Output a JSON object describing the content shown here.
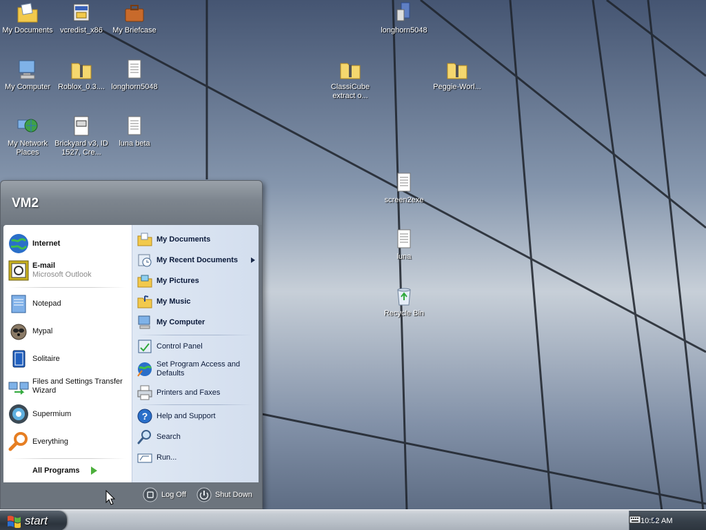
{
  "desktop": {
    "icons": [
      {
        "label": "My Documents"
      },
      {
        "label": "vcredist_x86"
      },
      {
        "label": "My Briefcase"
      },
      {
        "label": "longhorn5048"
      },
      {
        "label": "My Computer"
      },
      {
        "label": "Roblox_0.3...."
      },
      {
        "label": "longhorn5048"
      },
      {
        "label": "ClassiCube extract o..."
      },
      {
        "label": "Peggie-Worl..."
      },
      {
        "label": "My Network Places"
      },
      {
        "label": "Brickyard v3, ID 1527, Cre..."
      },
      {
        "label": "luna beta"
      },
      {
        "label": "screen2exe"
      },
      {
        "label": "luna"
      },
      {
        "label": "Recycle Bin"
      }
    ]
  },
  "start_menu": {
    "user": "VM2",
    "pinned": [
      {
        "title": "Internet"
      },
      {
        "title": "E-mail",
        "subtitle": "Microsoft Outlook"
      }
    ],
    "recent": [
      {
        "title": "Notepad"
      },
      {
        "title": "Mypal"
      },
      {
        "title": "Solitaire"
      },
      {
        "title": "Files and Settings Transfer Wizard"
      },
      {
        "title": "Supermium"
      },
      {
        "title": "Everything"
      }
    ],
    "all_programs": "All Programs",
    "places": [
      {
        "title": "My Documents"
      },
      {
        "title": "My Recent Documents"
      },
      {
        "title": "My Pictures"
      },
      {
        "title": "My Music"
      },
      {
        "title": "My Computer"
      }
    ],
    "settings": [
      {
        "title": "Control Panel"
      },
      {
        "title": "Set Program Access and Defaults"
      },
      {
        "title": "Printers and Faxes"
      }
    ],
    "help": [
      {
        "title": "Help and Support"
      },
      {
        "title": "Search"
      },
      {
        "title": "Run..."
      }
    ],
    "log_off": "Log Off",
    "shut_down": "Shut Down"
  },
  "taskbar": {
    "start_label": "start",
    "clock": "10:52 AM"
  },
  "colors": {
    "taskbar": "#b9c0c8",
    "start_button": "#3d4650",
    "menu_right": "#d3deee"
  }
}
